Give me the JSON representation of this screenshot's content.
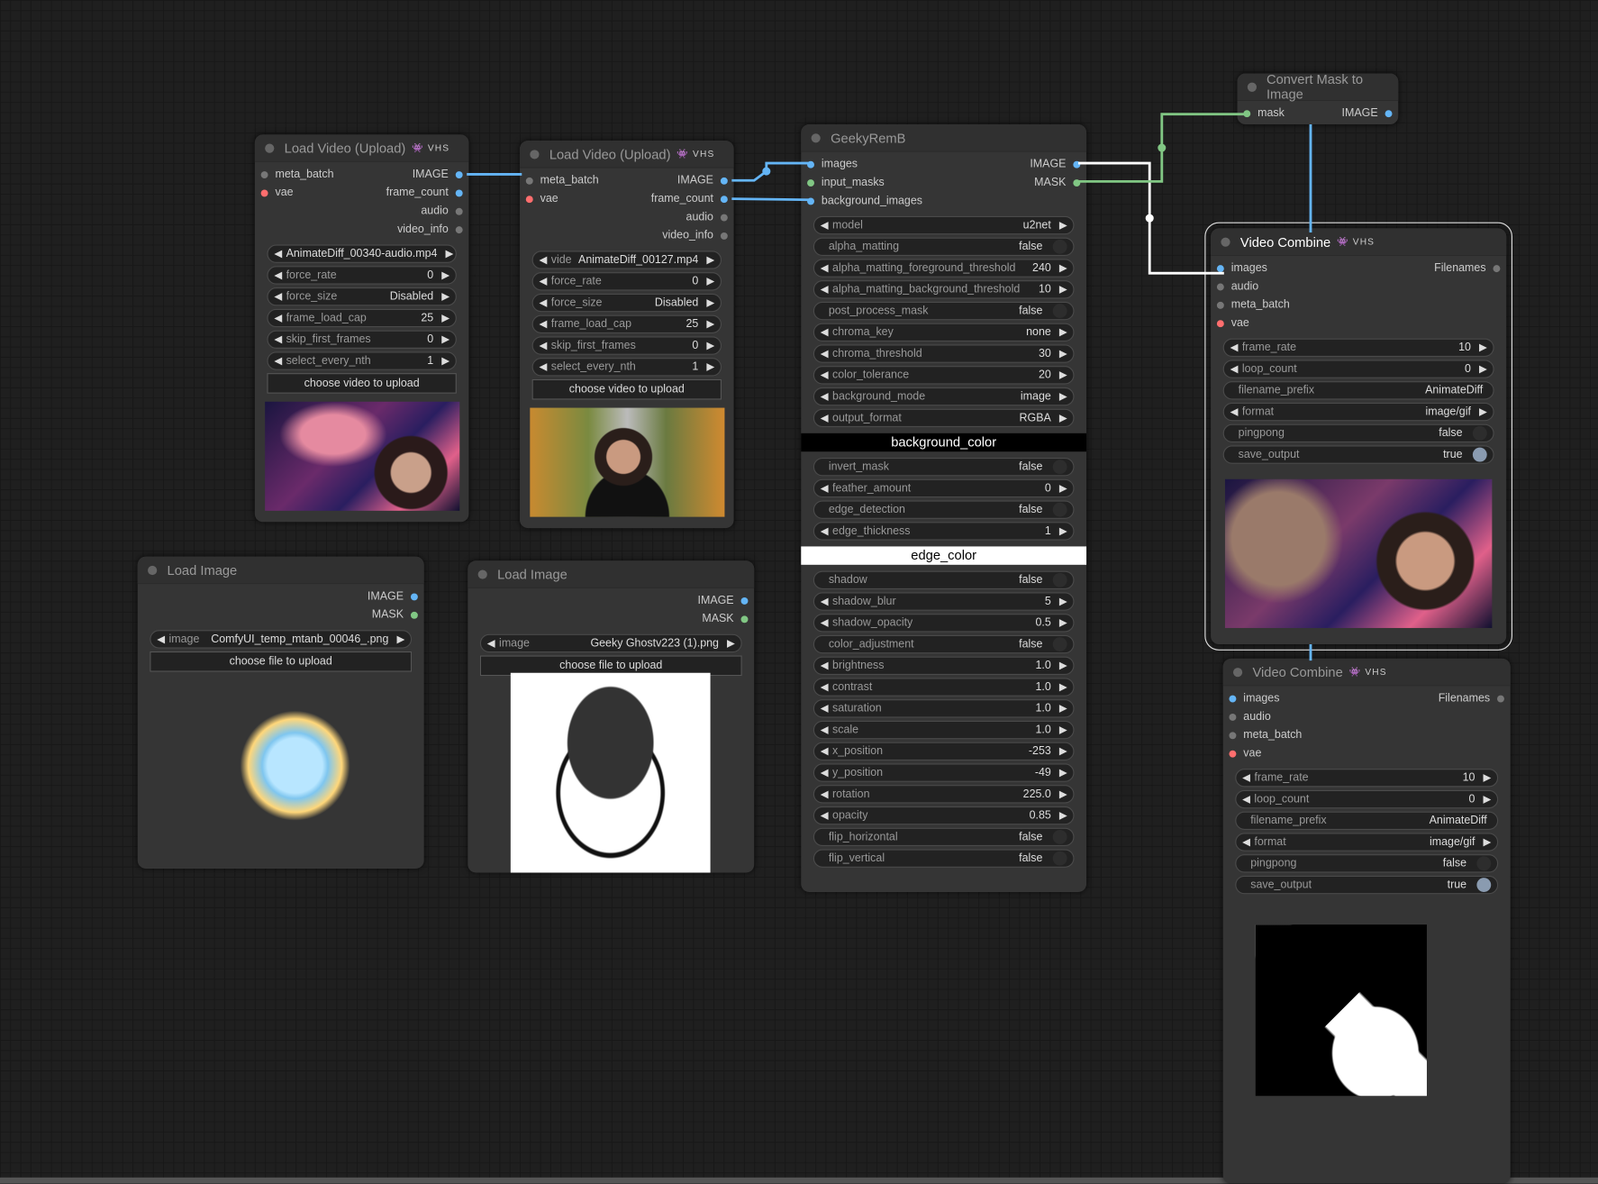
{
  "colors": {
    "image": "#64b5f6",
    "mask": "#81c784",
    "vae": "#ff6e6e",
    "other": "#777"
  },
  "nodes": [
    {
      "id": "lv1",
      "title": "Load Video (Upload)",
      "badge": "👾 VHS",
      "inputs": [
        {
          "label": "meta_batch",
          "type": "other"
        },
        {
          "label": "vae",
          "type": "vae"
        }
      ],
      "outputs": [
        {
          "label": "IMAGE",
          "type": "image"
        },
        {
          "label": "frame_count",
          "type": "image"
        },
        {
          "label": "audio",
          "type": "other"
        },
        {
          "label": "video_info",
          "type": "other"
        }
      ],
      "widgets": [
        {
          "kind": "combo",
          "label": "",
          "value": "AnimateDiff_00340-audio.mp4"
        },
        {
          "kind": "combo",
          "label": "force_rate",
          "value": "0"
        },
        {
          "kind": "combo",
          "label": "force_size",
          "value": "Disabled"
        },
        {
          "kind": "combo",
          "label": "frame_load_cap",
          "value": "25"
        },
        {
          "kind": "combo",
          "label": "skip_first_frames",
          "value": "0"
        },
        {
          "kind": "combo",
          "label": "select_every_nth",
          "value": "1"
        },
        {
          "kind": "button",
          "label": "choose video to upload"
        }
      ],
      "preview": "galaxy-portrait"
    },
    {
      "id": "lv2",
      "title": "Load Video (Upload)",
      "badge": "👾 VHS",
      "inputs": [
        {
          "label": "meta_batch",
          "type": "other"
        },
        {
          "label": "vae",
          "type": "vae"
        }
      ],
      "outputs": [
        {
          "label": "IMAGE",
          "type": "image"
        },
        {
          "label": "frame_count",
          "type": "image"
        },
        {
          "label": "audio",
          "type": "other"
        },
        {
          "label": "video_info",
          "type": "other"
        }
      ],
      "widgets": [
        {
          "kind": "combo",
          "label": "vide",
          "value": "AnimateDiff_00127.mp4"
        },
        {
          "kind": "combo",
          "label": "force_rate",
          "value": "0"
        },
        {
          "kind": "combo",
          "label": "force_size",
          "value": "Disabled"
        },
        {
          "kind": "combo",
          "label": "frame_load_cap",
          "value": "25"
        },
        {
          "kind": "combo",
          "label": "skip_first_frames",
          "value": "0"
        },
        {
          "kind": "combo",
          "label": "select_every_nth",
          "value": "1"
        },
        {
          "kind": "button",
          "label": "choose video to upload"
        }
      ],
      "preview": "park-portrait"
    },
    {
      "id": "li1",
      "title": "Load Image",
      "badge": "",
      "inputs": [],
      "outputs": [
        {
          "label": "IMAGE",
          "type": "image"
        },
        {
          "label": "MASK",
          "type": "mask"
        }
      ],
      "widgets": [
        {
          "kind": "combo",
          "label": "image",
          "value": "ComfyUI_temp_mtanb_00046_.png"
        },
        {
          "kind": "button",
          "label": "choose file to upload"
        }
      ],
      "preview": "mascot"
    },
    {
      "id": "li2",
      "title": "Load Image",
      "badge": "",
      "inputs": [],
      "outputs": [
        {
          "label": "IMAGE",
          "type": "image"
        },
        {
          "label": "MASK",
          "type": "mask"
        }
      ],
      "widgets": [
        {
          "kind": "combo",
          "label": "image",
          "value": "Geeky Ghostv223 (1).png"
        },
        {
          "kind": "button",
          "label": "choose file to upload"
        }
      ],
      "preview": "ghost"
    },
    {
      "id": "geeky",
      "title": "GeekyRemB",
      "badge": "",
      "inputs": [
        {
          "label": "images",
          "type": "image"
        },
        {
          "label": "input_masks",
          "type": "mask"
        },
        {
          "label": "background_images",
          "type": "image"
        }
      ],
      "outputs": [
        {
          "label": "IMAGE",
          "type": "image"
        },
        {
          "label": "MASK",
          "type": "mask"
        }
      ],
      "widgets": [
        {
          "kind": "combo",
          "label": "model",
          "value": "u2net"
        },
        {
          "kind": "toggle",
          "label": "alpha_matting",
          "value": "false"
        },
        {
          "kind": "combo",
          "label": "alpha_matting_foreground_threshold",
          "value": "240"
        },
        {
          "kind": "combo",
          "label": "alpha_matting_background_threshold",
          "value": "10"
        },
        {
          "kind": "toggle",
          "label": "post_process_mask",
          "value": "false"
        },
        {
          "kind": "combo",
          "label": "chroma_key",
          "value": "none"
        },
        {
          "kind": "combo",
          "label": "chroma_threshold",
          "value": "30"
        },
        {
          "kind": "combo",
          "label": "color_tolerance",
          "value": "20"
        },
        {
          "kind": "combo",
          "label": "background_mode",
          "value": "image"
        },
        {
          "kind": "combo",
          "label": "output_format",
          "value": "RGBA"
        },
        {
          "kind": "color",
          "label": "background_color",
          "value": "#000000"
        },
        {
          "kind": "toggle",
          "label": "invert_mask",
          "value": "false"
        },
        {
          "kind": "combo",
          "label": "feather_amount",
          "value": "0"
        },
        {
          "kind": "toggle",
          "label": "edge_detection",
          "value": "false"
        },
        {
          "kind": "combo",
          "label": "edge_thickness",
          "value": "1"
        },
        {
          "kind": "color",
          "label": "edge_color",
          "value": "#ffffff"
        },
        {
          "kind": "toggle",
          "label": "shadow",
          "value": "false"
        },
        {
          "kind": "combo",
          "label": "shadow_blur",
          "value": "5"
        },
        {
          "kind": "combo",
          "label": "shadow_opacity",
          "value": "0.5"
        },
        {
          "kind": "toggle",
          "label": "color_adjustment",
          "value": "false"
        },
        {
          "kind": "combo",
          "label": "brightness",
          "value": "1.0"
        },
        {
          "kind": "combo",
          "label": "contrast",
          "value": "1.0"
        },
        {
          "kind": "combo",
          "label": "saturation",
          "value": "1.0"
        },
        {
          "kind": "combo",
          "label": "scale",
          "value": "1.0"
        },
        {
          "kind": "combo",
          "label": "x_position",
          "value": "-253"
        },
        {
          "kind": "combo",
          "label": "y_position",
          "value": "-49"
        },
        {
          "kind": "combo",
          "label": "rotation",
          "value": "225.0"
        },
        {
          "kind": "combo",
          "label": "opacity",
          "value": "0.85"
        },
        {
          "kind": "toggle",
          "label": "flip_horizontal",
          "value": "false"
        },
        {
          "kind": "toggle",
          "label": "flip_vertical",
          "value": "false"
        }
      ],
      "preview": ""
    },
    {
      "id": "cm",
      "title": "Convert Mask to Image",
      "badge": "",
      "inputs": [
        {
          "label": "mask",
          "type": "mask"
        }
      ],
      "outputs": [
        {
          "label": "IMAGE",
          "type": "image"
        }
      ],
      "widgets": [],
      "preview": ""
    },
    {
      "id": "vc1",
      "title": "Video Combine",
      "badge": "👾 VHS",
      "selected": true,
      "inputs": [
        {
          "label": "images",
          "type": "image"
        },
        {
          "label": "audio",
          "type": "other"
        },
        {
          "label": "meta_batch",
          "type": "other"
        },
        {
          "label": "vae",
          "type": "vae"
        }
      ],
      "outputs": [
        {
          "label": "Filenames",
          "type": "other"
        }
      ],
      "widgets": [
        {
          "kind": "combo",
          "label": "frame_rate",
          "value": "10"
        },
        {
          "kind": "combo",
          "label": "loop_count",
          "value": "0"
        },
        {
          "kind": "text",
          "label": "filename_prefix",
          "value": "AnimateDiff"
        },
        {
          "kind": "combo",
          "label": "format",
          "value": "image/gif"
        },
        {
          "kind": "toggle",
          "label": "pingpong",
          "value": "false"
        },
        {
          "kind": "toggle",
          "label": "save_output",
          "value": "true"
        }
      ],
      "preview": "composite"
    },
    {
      "id": "vc2",
      "title": "Video Combine",
      "badge": "👾 VHS",
      "inputs": [
        {
          "label": "images",
          "type": "image"
        },
        {
          "label": "audio",
          "type": "other"
        },
        {
          "label": "meta_batch",
          "type": "other"
        },
        {
          "label": "vae",
          "type": "vae"
        }
      ],
      "outputs": [
        {
          "label": "Filenames",
          "type": "other"
        }
      ],
      "widgets": [
        {
          "kind": "combo",
          "label": "frame_rate",
          "value": "10"
        },
        {
          "kind": "combo",
          "label": "loop_count",
          "value": "0"
        },
        {
          "kind": "text",
          "label": "filename_prefix",
          "value": "AnimateDiff"
        },
        {
          "kind": "combo",
          "label": "format",
          "value": "image/gif"
        },
        {
          "kind": "toggle",
          "label": "pingpong",
          "value": "false"
        },
        {
          "kind": "toggle",
          "label": "save_output",
          "value": "true"
        }
      ],
      "preview": "mask"
    }
  ]
}
